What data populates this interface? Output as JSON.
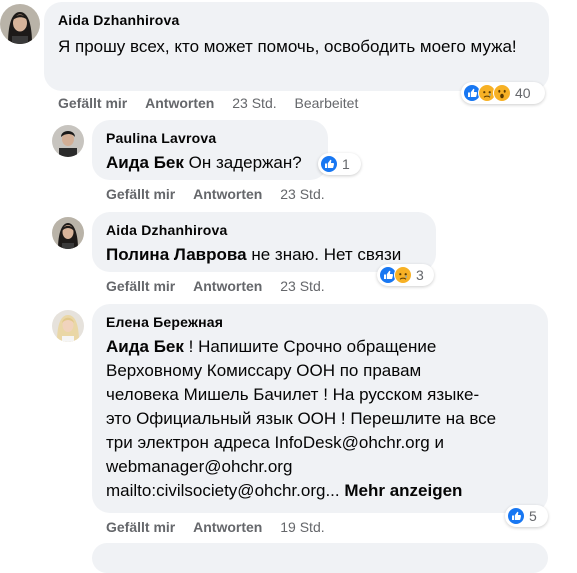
{
  "colors": {
    "bubble_bg": "#f0f2f5",
    "meta_text": "#65676b",
    "like_blue": "#1877f2",
    "reaction_yellow": "#f7b125"
  },
  "comments": [
    {
      "author": "Aida Dzhanhirova",
      "avatar_icon": "woman-dark-hair-avatar",
      "text": "Я прошу всех, кто может помочь, освободить моего мужа!",
      "reactions": [
        "like-icon",
        "sad-icon",
        "wow-icon"
      ],
      "reaction_count": "40",
      "actions": {
        "like": "Gefällt mir",
        "reply": "Antworten",
        "time": "23 Std.",
        "edited": "Bearbeitet"
      }
    },
    {
      "author": "Paulina Lavrova",
      "avatar_icon": "man-dark-hair-avatar",
      "mention": "Аида Бек",
      "text": "Он задержан?",
      "reactions": [
        "like-icon"
      ],
      "reaction_count": "1",
      "actions": {
        "like": "Gefällt mir",
        "reply": "Antworten",
        "time": "23 Std."
      }
    },
    {
      "author": "Aida Dzhanhirova",
      "avatar_icon": "woman-dark-hair-avatar",
      "mention": "Полина Лаврова",
      "text": "не знаю. Нет связи",
      "reactions": [
        "like-icon",
        "sad-icon"
      ],
      "reaction_count": "3",
      "actions": {
        "like": "Gefällt mir",
        "reply": "Antworten",
        "time": "23 Std."
      }
    },
    {
      "author": "Елена Бережная",
      "avatar_icon": "blonde-woman-avatar",
      "mention": "Аида Бек",
      "lines": [
        "! Напишите Срочно обращение",
        "Верховному Комиссару ООН по правам",
        "человека Мишель Бачилет ! На русском языке-",
        "это Официальный язык ООН ! Перешлите на все",
        "три электрон адреса InfoDesk@ohchr.org и",
        "webmanager@ohchr.org",
        "mailto:civilsociety@ohchr.org..."
      ],
      "see_more": "Mehr anzeigen",
      "reactions": [
        "like-icon"
      ],
      "reaction_count": "5",
      "actions": {
        "like": "Gefällt mir",
        "reply": "Antworten",
        "time": "19 Std."
      }
    }
  ]
}
